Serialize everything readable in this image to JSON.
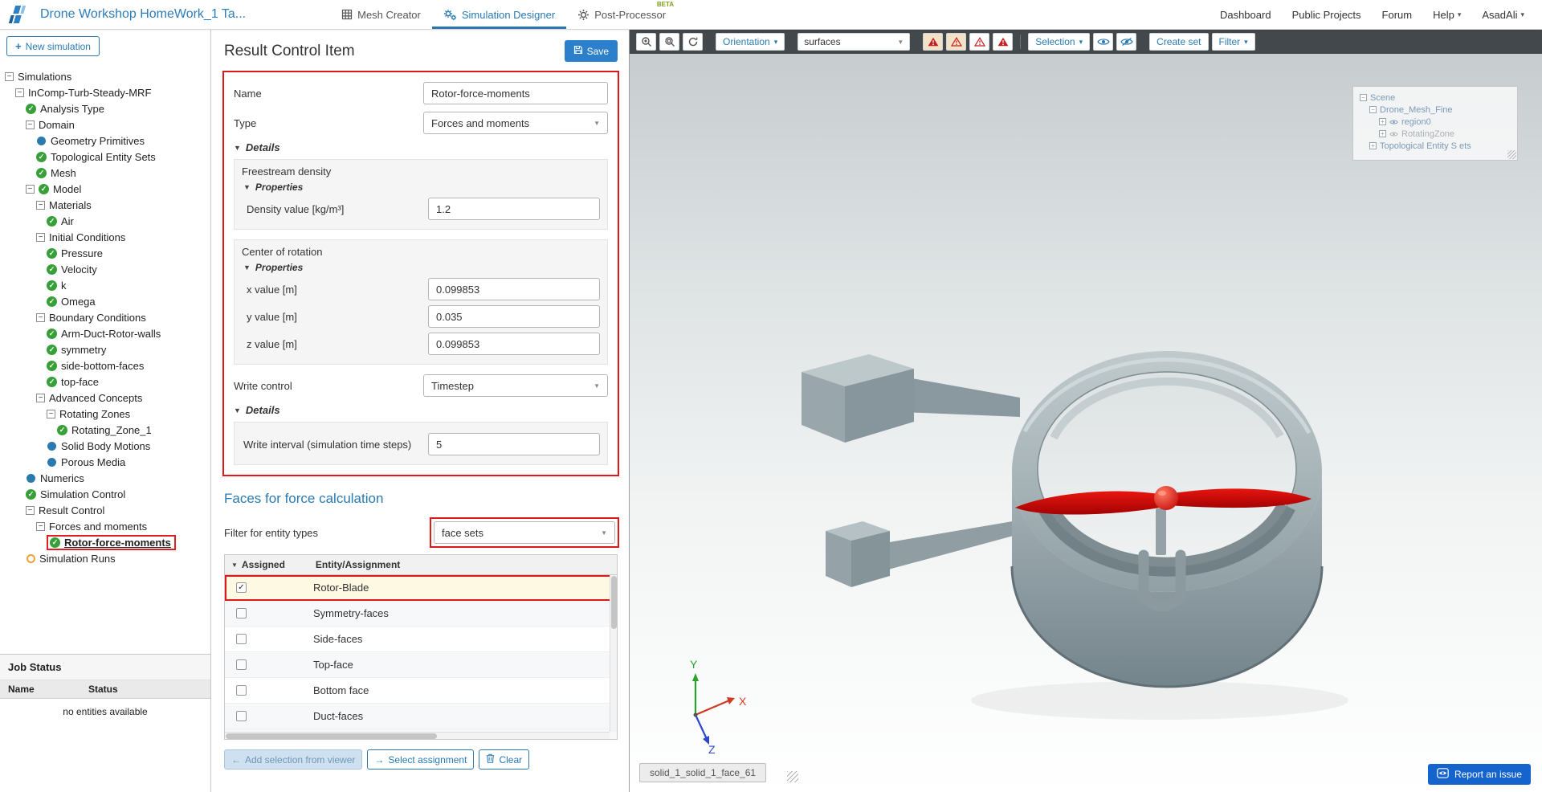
{
  "colors": {
    "accent_blue": "#2a7ab0",
    "save_blue": "#2c80cb",
    "highlight_red": "#e11818",
    "check_green": "#38a038",
    "pending_orange": "#f0a038",
    "blade_red": "#d21010"
  },
  "header": {
    "project_title": "Drone Workshop HomeWork_1 Ta...",
    "tabs": [
      {
        "label": "Mesh Creator",
        "icon": "mesh",
        "active": false
      },
      {
        "label": "Simulation Designer",
        "icon": "gears",
        "active": true
      },
      {
        "label": "Post-Processor",
        "icon": "gear",
        "active": false,
        "badge": "BETA"
      }
    ],
    "nav": [
      {
        "label": "Dashboard",
        "caret": false
      },
      {
        "label": "Public Projects",
        "caret": false
      },
      {
        "label": "Forum",
        "caret": false
      },
      {
        "label": "Help",
        "caret": true
      },
      {
        "label": "AsadAli",
        "caret": true
      }
    ]
  },
  "sidebar": {
    "new_simulation_label": "New simulation",
    "tree": [
      {
        "label": "Simulations",
        "level": 0,
        "box": "minus"
      },
      {
        "label": "InComp-Turb-Steady-MRF",
        "level": 1,
        "box": "minus"
      },
      {
        "label": "Analysis Type",
        "level": 2,
        "icon": "check"
      },
      {
        "label": "Domain",
        "level": 2,
        "box": "minus"
      },
      {
        "label": "Geometry Primitives",
        "level": 3,
        "icon": "dot"
      },
      {
        "label": "Topological Entity Sets",
        "level": 3,
        "icon": "check"
      },
      {
        "label": "Mesh",
        "level": 3,
        "icon": "check"
      },
      {
        "label": "Model",
        "level": 2,
        "box": "minus",
        "icon": "check"
      },
      {
        "label": "Materials",
        "level": 3,
        "box": "minus"
      },
      {
        "label": "Air",
        "level": 4,
        "icon": "check"
      },
      {
        "label": "Initial Conditions",
        "level": 3,
        "box": "minus"
      },
      {
        "label": "Pressure",
        "level": 4,
        "icon": "check"
      },
      {
        "label": "Velocity",
        "level": 4,
        "icon": "check"
      },
      {
        "label": "k",
        "level": 4,
        "icon": "check"
      },
      {
        "label": "Omega",
        "level": 4,
        "icon": "check"
      },
      {
        "label": "Boundary Conditions",
        "level": 3,
        "box": "minus"
      },
      {
        "label": "Arm-Duct-Rotor-walls",
        "level": 4,
        "icon": "check"
      },
      {
        "label": "symmetry",
        "level": 4,
        "icon": "check"
      },
      {
        "label": "side-bottom-faces",
        "level": 4,
        "icon": "check"
      },
      {
        "label": "top-face",
        "level": 4,
        "icon": "check"
      },
      {
        "label": "Advanced Concepts",
        "level": 3,
        "box": "minus"
      },
      {
        "label": "Rotating Zones",
        "level": 4,
        "box": "minus"
      },
      {
        "label": "Rotating_Zone_1",
        "level": 5,
        "icon": "check"
      },
      {
        "label": "Solid Body Motions",
        "level": 4,
        "icon": "dot"
      },
      {
        "label": "Porous Media",
        "level": 4,
        "icon": "dot"
      },
      {
        "label": "Numerics",
        "level": 2,
        "icon": "dot"
      },
      {
        "label": "Simulation Control",
        "level": 2,
        "icon": "check"
      },
      {
        "label": "Result Control",
        "level": 2,
        "box": "minus"
      },
      {
        "label": "Forces and moments",
        "level": 3,
        "box": "minus"
      },
      {
        "label": "Rotor-force-moments",
        "level": 4,
        "icon": "check",
        "selected": true
      },
      {
        "label": "Simulation Runs",
        "level": 2,
        "icon": "circle"
      }
    ],
    "job_status": {
      "title": "Job Status",
      "columns": [
        "Name",
        "Status"
      ],
      "empty_text": "no entities available"
    }
  },
  "panel": {
    "title": "Result Control Item",
    "save_label": "Save",
    "name_label": "Name",
    "name_value": "Rotor-force-moments",
    "type_label": "Type",
    "type_value": "Forces and moments",
    "details_label": "Details",
    "properties_label": "Properties",
    "freestream_title": "Freestream density",
    "density_label": "Density value [kg/m³]",
    "density_value": "1.2",
    "cor_title": "Center of rotation",
    "x_label": "x value [m]",
    "x_value": "0.099853",
    "y_label": "y value [m]",
    "y_value": "0.035",
    "z_label": "z value [m]",
    "z_value": "0.099853",
    "write_control_label": "Write control",
    "write_control_value": "Timestep",
    "write_details_label": "Details",
    "write_interval_label": "Write interval (simulation time steps)",
    "write_interval_value": "5",
    "faces": {
      "title": "Faces for force calculation",
      "filter_label": "Filter for entity types",
      "filter_value": "face sets",
      "col_assigned": "Assigned",
      "col_entity": "Entity/Assignment",
      "rows": [
        {
          "label": "Rotor-Blade",
          "checked": true
        },
        {
          "label": "Symmetry-faces",
          "checked": false
        },
        {
          "label": "Side-faces",
          "checked": false
        },
        {
          "label": "Top-face",
          "checked": false
        },
        {
          "label": "Bottom face",
          "checked": false
        },
        {
          "label": "Duct-faces",
          "checked": false
        }
      ],
      "add_selection_label": "Add selection from viewer",
      "select_assignment_label": "Select assignment",
      "clear_label": "Clear"
    }
  },
  "viewer": {
    "toolbar": {
      "orientation_label": "Orientation",
      "render_mode_value": "surfaces",
      "selection_label": "Selection",
      "create_set_label": "Create set",
      "filter_label": "Filter"
    },
    "scene_tree": [
      {
        "label": "Scene",
        "level": 0,
        "box": "minus",
        "tone": "blue"
      },
      {
        "label": "Drone_Mesh_Fine",
        "level": 1,
        "box": "minus",
        "tone": "blue"
      },
      {
        "label": "region0",
        "level": 2,
        "box": "plus",
        "eye": true,
        "tone": "blue"
      },
      {
        "label": "RotatingZone",
        "level": 2,
        "box": "plus",
        "eye": true,
        "tone": "gray"
      },
      {
        "label": "Topological Entity S ets",
        "level": 1,
        "box": "plus",
        "tone": "blue"
      }
    ],
    "face_label": "solid_1_solid_1_face_61",
    "report_issue_label": "Report an issue",
    "axes": {
      "x": "X",
      "y": "Y",
      "z": "Z"
    }
  }
}
